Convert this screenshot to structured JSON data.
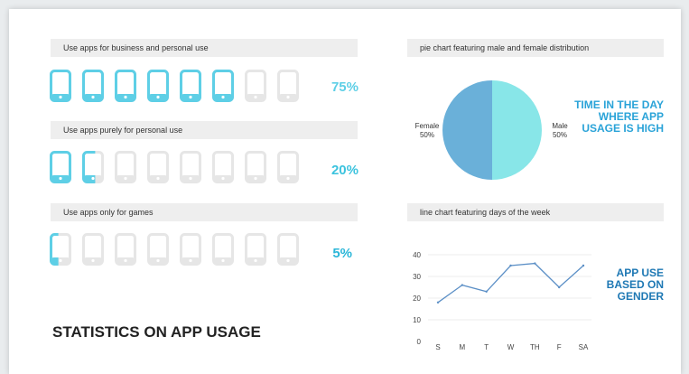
{
  "title": "STATISTICS ON APP USAGE",
  "rows": [
    {
      "label": "Use apps for business and personal use",
      "percent_text": "75%",
      "fill_fraction": 0.75
    },
    {
      "label": "Use apps purely for personal use",
      "percent_text": "20%",
      "fill_fraction": 0.2
    },
    {
      "label": "Use apps only for games",
      "percent_text": "5%",
      "fill_fraction": 0.05
    }
  ],
  "pie_header": "pie chart featuring male and female distribution",
  "line_header": "line chart featuring days of the week",
  "callout_time": "TIME IN THE DAY WHERE APP USAGE IS HIGH",
  "callout_gender": "APP USE BASED ON GENDER",
  "colors": {
    "phone_active": "#5ecfe6",
    "phone_inactive": "#e6e6e6",
    "pie_female": "#6ab0d9",
    "pie_male": "#88e6e8",
    "line": "#5b8fc6",
    "callout": "#2aa3d8"
  },
  "chart_data": [
    {
      "type": "pie",
      "slices": [
        {
          "label": "Female",
          "value_label": "50%",
          "value": 50
        },
        {
          "label": "Male",
          "value_label": "50%",
          "value": 50
        }
      ]
    },
    {
      "type": "line",
      "categories": [
        "S",
        "M",
        "T",
        "W",
        "TH",
        "F",
        "SA"
      ],
      "values": [
        18,
        26,
        23,
        35,
        36,
        25,
        35
      ],
      "ylim": [
        0,
        40
      ],
      "yticks": [
        "0",
        "10",
        "20",
        "30",
        "40"
      ],
      "grid": true
    }
  ]
}
